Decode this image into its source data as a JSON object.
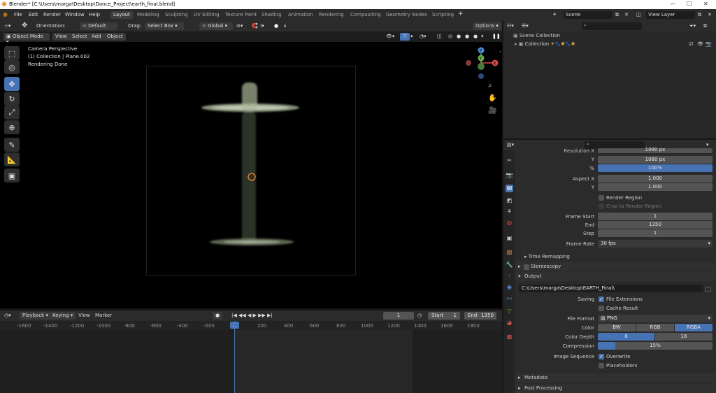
{
  "window": {
    "title": "Blender* [C:\\Users\\marga\\Desktop\\Dance_Project\\earth_final.blend]"
  },
  "menu": [
    "File",
    "Edit",
    "Render",
    "Window",
    "Help"
  ],
  "workspaces": [
    "Layout",
    "Modeling",
    "Sculpting",
    "UV Editing",
    "Texture Paint",
    "Shading",
    "Animation",
    "Rendering",
    "Compositing",
    "Geometry Nodes",
    "Scripting"
  ],
  "scene": {
    "name": "Scene",
    "view_layer": "View Layer"
  },
  "viewport_header": {
    "orientation_label": "Orientation:",
    "orientation_value": "Default",
    "drag_label": "Drag:",
    "drag_value": "Select Box",
    "transform_orientation": "Global",
    "options": "Options",
    "mode": "Object Mode",
    "view": "View",
    "select": "Select",
    "add": "Add",
    "object": "Object"
  },
  "viewport_info": {
    "line1": "Camera Perspective",
    "line2": "(1) Collection | Plane.002",
    "line3": "Rendering Done"
  },
  "gizmo": {
    "z": "Z",
    "y": "Y",
    "x": "X"
  },
  "timeline": {
    "playback": "Playback",
    "keying": "Keying",
    "view": "View",
    "marker": "Marker",
    "current_frame": "1",
    "start_label": "Start",
    "start_value": "1",
    "end_label": "End",
    "end_value": "1350",
    "ticks": [
      "-1600",
      "-1400",
      "-1200",
      "-1000",
      "-800",
      "-600",
      "-400",
      "-200",
      "1",
      "200",
      "400",
      "600",
      "800",
      "1000",
      "1200",
      "1400",
      "1600",
      "1800"
    ]
  },
  "outliner": {
    "scene_collection": "Scene Collection",
    "collection": "Collection"
  },
  "properties": {
    "resolution_x_label": "Resolution X",
    "resolution_x_value": "1080 px",
    "y_label": "Y",
    "resolution_y_value": "1080 px",
    "percent_label": "%",
    "percent_value": "100%",
    "aspect_x_label": "Aspect X",
    "aspect_x_value": "1.000",
    "aspect_y_label": "Y",
    "aspect_y_value": "1.000",
    "render_region": "Render Region",
    "crop_region": "Crop to Render Region",
    "frame_start_label": "Frame Start",
    "frame_start_value": "1",
    "end_label": "End",
    "end_value": "1350",
    "step_label": "Step",
    "step_value": "1",
    "frame_rate_label": "Frame Rate",
    "frame_rate_value": "30 fps",
    "time_remapping": "Time Remapping",
    "stereoscopy": "Stereoscopy",
    "output_section": "Output",
    "output_path": "C:\\Users\\marga\\Desktop\\EARTH_Final\\",
    "saving_label": "Saving",
    "file_extensions": "File Extensions",
    "cache_result": "Cache Result",
    "file_format_label": "File Format",
    "file_format_value": "PNG",
    "color_label": "Color",
    "color_options": [
      "BW",
      "RGB",
      "RGBA"
    ],
    "color_depth_label": "Color Depth",
    "color_depth_options": [
      "8",
      "16"
    ],
    "compression_label": "Compression",
    "compression_value": "15%",
    "compression_fraction": 0.15,
    "image_sequence_label": "Image Sequence",
    "overwrite": "Overwrite",
    "placeholders": "Placeholders",
    "metadata": "Metadata",
    "post_processing": "Post Processing"
  },
  "colors": {
    "accent": "#4772b3",
    "background": "#1d1d1d",
    "panel": "#2b2b2b"
  }
}
